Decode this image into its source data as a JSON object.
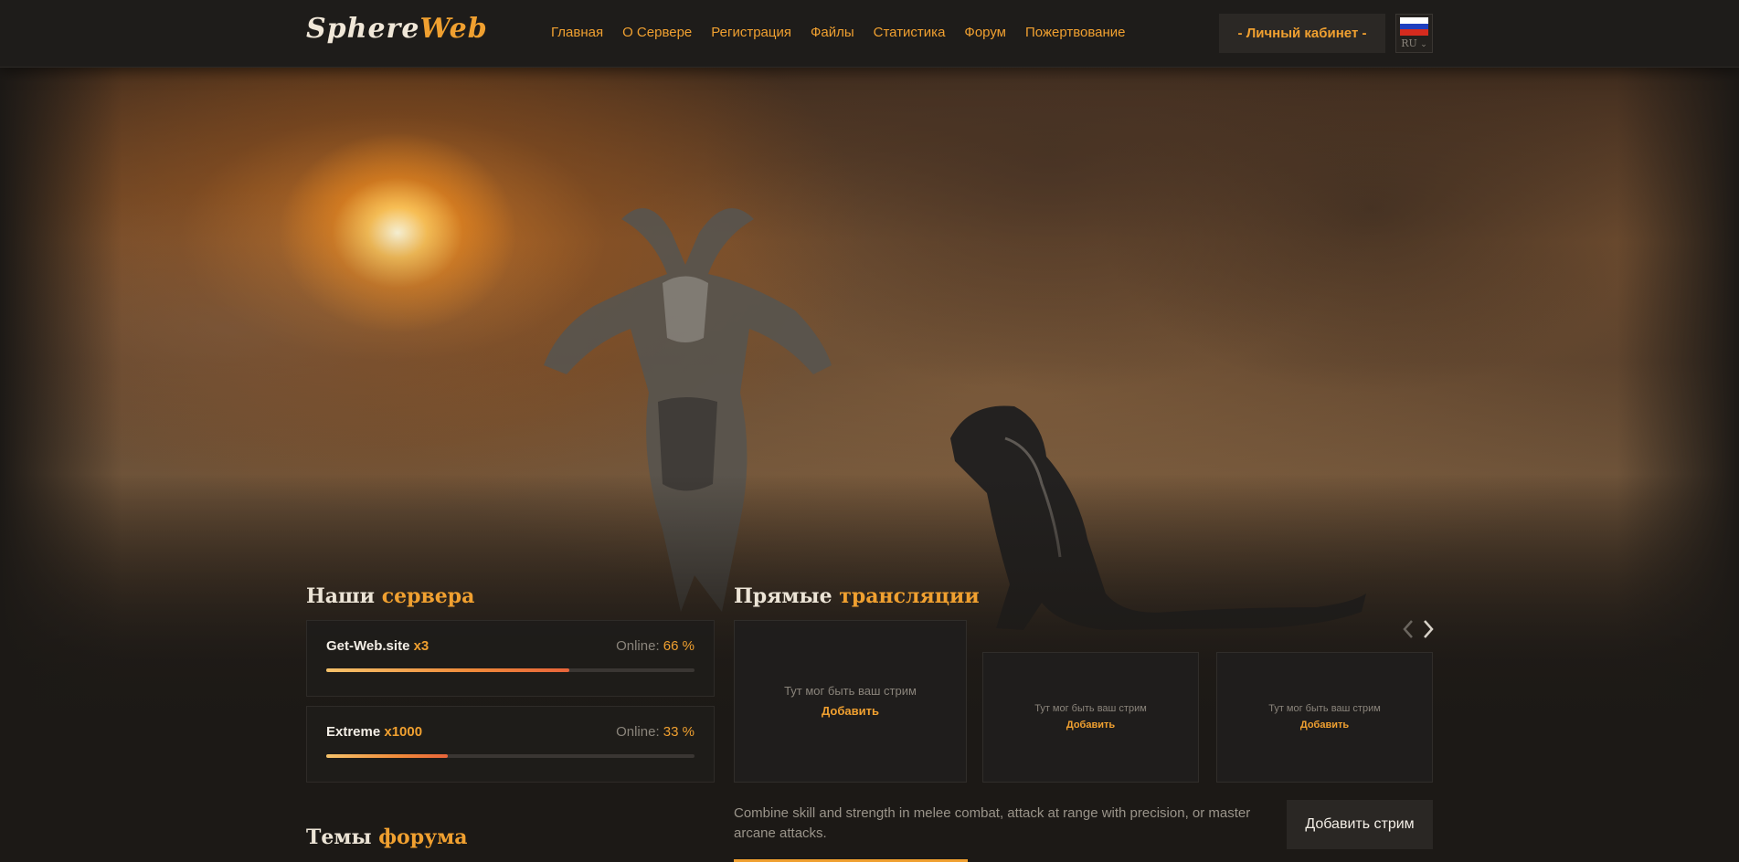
{
  "header": {
    "logo_part1": "Sphere",
    "logo_part2": "Web",
    "nav": [
      "Главная",
      "О Сервере",
      "Регистрация",
      "Файлы",
      "Статистика",
      "Форум",
      "Пожертвование"
    ],
    "cabinet_label": "- Личный кабинет -",
    "language_code": "RU",
    "flag_colors": [
      "#ffffff",
      "#1f3fbf",
      "#d52b1e"
    ]
  },
  "servers": {
    "title_plain": "Наши",
    "title_accent": "сервера",
    "online_label": "Online:",
    "items": [
      {
        "name": "Get-Web.site",
        "rate": "x3",
        "online": "66 %",
        "fill": 0.66
      },
      {
        "name": "Extreme",
        "rate": "x1000",
        "online": "33 %",
        "fill": 0.33
      }
    ]
  },
  "streams": {
    "title_plain": "Прямые",
    "title_accent": "трансляции",
    "placeholder_text": "Тут мог быть ваш стрим",
    "add_link": "Добавить",
    "description": "Combine skill and strength in melee combat, attack at range with precision, or master arcane attacks.",
    "add_button": "Добавить стрим"
  },
  "forum": {
    "title_plain": "Темы",
    "title_accent": "форума"
  },
  "colors": {
    "accent": "#f0a030",
    "background": "#1c1916"
  }
}
